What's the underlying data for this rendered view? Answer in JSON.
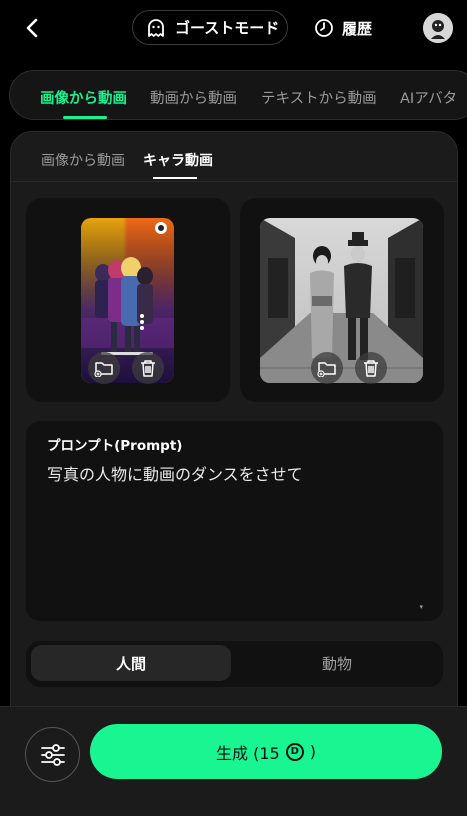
{
  "header": {
    "ghost_mode_label": "ゴーストモード",
    "history_label": "履歴"
  },
  "main_tabs": [
    {
      "label": "画像から動画",
      "active": true
    },
    {
      "label": "動画から動画",
      "active": false
    },
    {
      "label": "テキストから動画",
      "active": false
    },
    {
      "label": "AIアバタ",
      "active": false
    }
  ],
  "sub_tabs": [
    {
      "label": "画像から動画",
      "active": false
    },
    {
      "label": "キャラ動画",
      "active": true
    }
  ],
  "prompt": {
    "title": "プロンプト(Prompt)",
    "value": "写真の人物に動画のダンスをさせて"
  },
  "subject_toggle": {
    "options": [
      "人間",
      "動物"
    ],
    "selected": "人間"
  },
  "generate": {
    "label": "生成 (15",
    "coin_symbol": "D",
    "suffix": ")"
  },
  "colors": {
    "accent": "#19f591",
    "background": "#000000",
    "card": "#1b1b1b"
  }
}
